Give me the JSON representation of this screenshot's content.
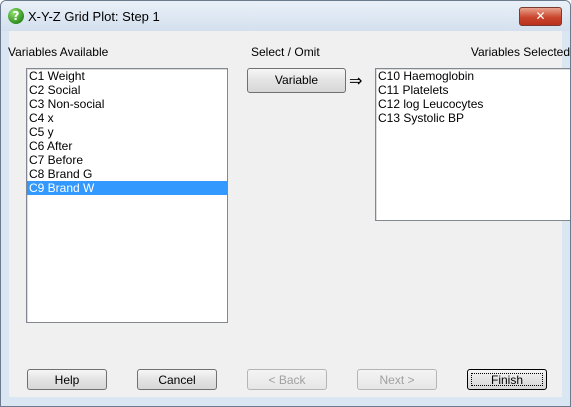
{
  "window": {
    "title": "X-Y-Z Grid Plot: Step 1",
    "close_glyph": "✕",
    "app_icon_glyph": "?"
  },
  "labels": {
    "available": "Variables Available",
    "select_omit": "Select / Omit",
    "selected": "Variables Selected"
  },
  "available_items": [
    "C1 Weight",
    "C2 Social",
    "C3 Non-social",
    "C4 x",
    "C5 y",
    "C6 After",
    "C7 Before",
    "C8 Brand G",
    "C9 Brand W"
  ],
  "available_selected_index": 8,
  "selected_items": [
    "C10 Haemoglobin",
    "C11 Platelets",
    "C12 log Leucocytes",
    "C13 Systolic BP"
  ],
  "transfer": {
    "button_label": "Variable",
    "arrow_glyph": "⇒"
  },
  "buttons": {
    "help": "Help",
    "cancel": "Cancel",
    "back": "< Back",
    "next": "Next >",
    "finish": "Finish"
  },
  "colors": {
    "selection": "#3399ff",
    "title_bar": "#dbe6f3",
    "close_button": "#c9452c"
  }
}
